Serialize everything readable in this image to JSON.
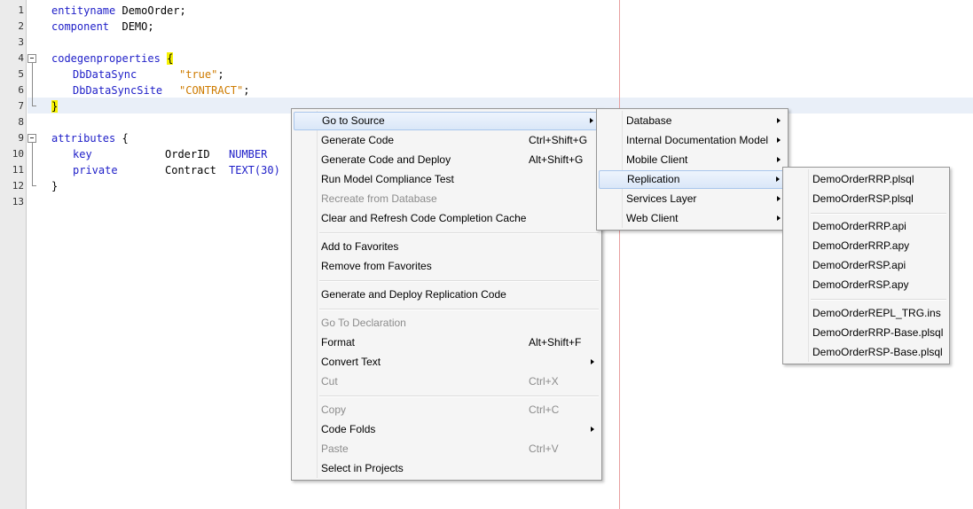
{
  "editor": {
    "line_numbers": [
      "1",
      "2",
      "3",
      "4",
      "5",
      "6",
      "7",
      "8",
      "9",
      "10",
      "11",
      "12",
      "13"
    ],
    "lines": {
      "l1": {
        "kw": "entityname",
        "rest": " DemoOrder;"
      },
      "l2": {
        "kw": "component",
        "rest": "  DEMO;"
      },
      "l4": {
        "kw": "codegenproperties",
        "brace": "{"
      },
      "l5": {
        "kw": "DbDataSync",
        "value": "\"true\"",
        "end": ";"
      },
      "l6": {
        "kw": "DbDataSyncSite",
        "value": "\"CONTRACT\"",
        "end": ";"
      },
      "l7": {
        "brace": "}"
      },
      "l9": {
        "kw": "attributes",
        "rest": " {"
      },
      "l10": {
        "kw": "key",
        "name": "OrderID",
        "type": "NUMBER"
      },
      "l11": {
        "kw": "private",
        "name": "Contract",
        "type": "TEXT(30)"
      },
      "l12": {
        "brace": "}"
      }
    }
  },
  "context_menu": {
    "items": [
      {
        "label": "Go to Source",
        "shortcut": ""
      },
      {
        "label": "Generate Code",
        "shortcut": "Ctrl+Shift+G"
      },
      {
        "label": "Generate Code and Deploy",
        "shortcut": "Alt+Shift+G"
      },
      {
        "label": "Run Model Compliance Test",
        "shortcut": ""
      },
      {
        "label": "Recreate from Database",
        "shortcut": ""
      },
      {
        "label": "Clear and Refresh Code Completion Cache",
        "shortcut": ""
      },
      {
        "label": "Add to Favorites",
        "shortcut": ""
      },
      {
        "label": "Remove from Favorites",
        "shortcut": ""
      },
      {
        "label": "Generate and Deploy Replication Code",
        "shortcut": ""
      },
      {
        "label": "Go To Declaration",
        "shortcut": ""
      },
      {
        "label": "Format",
        "shortcut": "Alt+Shift+F"
      },
      {
        "label": "Convert Text",
        "shortcut": ""
      },
      {
        "label": "Cut",
        "shortcut": "Ctrl+X"
      },
      {
        "label": "Copy",
        "shortcut": "Ctrl+C"
      },
      {
        "label": "Code Folds",
        "shortcut": ""
      },
      {
        "label": "Paste",
        "shortcut": "Ctrl+V"
      },
      {
        "label": "Select in Projects",
        "shortcut": ""
      }
    ]
  },
  "source_submenu": {
    "items": [
      "Database",
      "Internal Documentation Model",
      "Mobile Client",
      "Replication",
      "Services Layer",
      "Web Client"
    ]
  },
  "replication_submenu": {
    "items": [
      "DemoOrderRRP.plsql",
      "DemoOrderRSP.plsql",
      "DemoOrderRRP.api",
      "DemoOrderRRP.apy",
      "DemoOrderRSP.api",
      "DemoOrderRSP.apy",
      "DemoOrderREPL_TRG.ins",
      "DemoOrderRRP-Base.plsql",
      "DemoOrderRSP-Base.plsql"
    ]
  },
  "colors": {
    "keyword": "#1e1ec8",
    "string": "#ce7b00",
    "brace_highlight": "#f7f300",
    "menu_background": "#f5f5f5",
    "menu_selected": "#dae7f8"
  }
}
